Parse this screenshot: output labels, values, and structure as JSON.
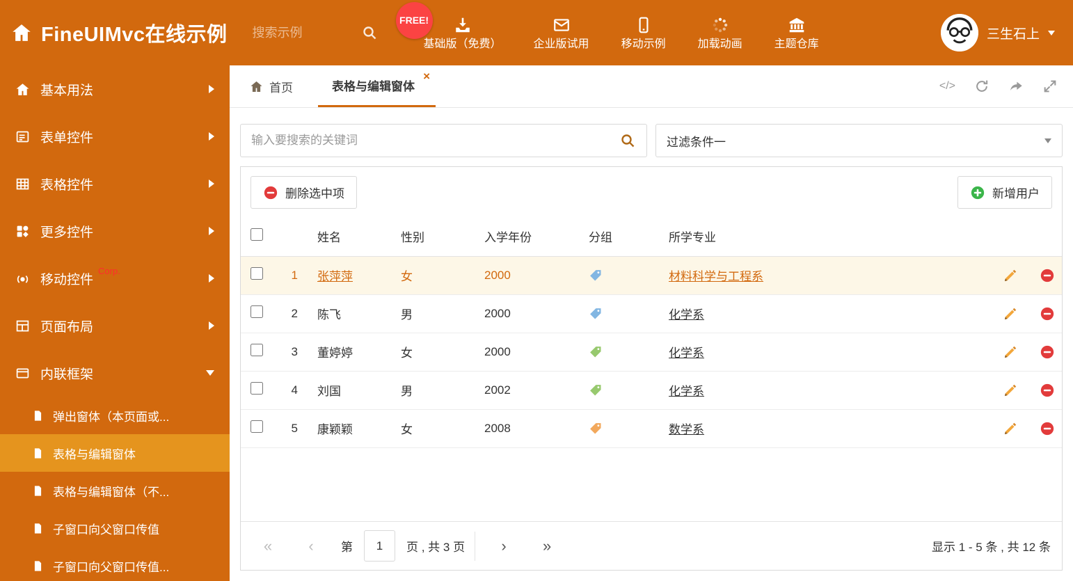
{
  "colors": {
    "primary": "#d2690e",
    "primary_light": "#e5941e",
    "link": "#d2690e",
    "red": "#e23b3b",
    "green": "#3bb54a",
    "free_red": "#fb4343",
    "selected_bg": "#fdf7e7",
    "tag_blue": "#82b6e2",
    "tag_green": "#97c96e",
    "tag_orange": "#f2a85c"
  },
  "icons": {
    "close": "×",
    "code": "</>",
    "first": "«",
    "prev": "‹",
    "next": "›",
    "last": "»"
  },
  "header": {
    "title": "FineUIMvc在线示例",
    "search_placeholder": "搜索示例",
    "free_badge": "FREE!",
    "nav": [
      {
        "label": "基础版（免费）"
      },
      {
        "label": "企业版试用"
      },
      {
        "label": "移动示例"
      },
      {
        "label": "加载动画"
      },
      {
        "label": "主题仓库"
      }
    ],
    "user_name": "三生石上"
  },
  "sidebar": {
    "items": [
      {
        "label": "基本用法",
        "arrow": "right"
      },
      {
        "label": "表单控件",
        "arrow": "right"
      },
      {
        "label": "表格控件",
        "arrow": "right"
      },
      {
        "label": "更多控件",
        "arrow": "right"
      },
      {
        "label": "移动控件",
        "badge": "Corp.",
        "arrow": "right"
      },
      {
        "label": "页面布局",
        "arrow": "right"
      },
      {
        "label": "内联框架",
        "arrow": "down"
      }
    ],
    "subitems": [
      {
        "label": "弹出窗体（本页面或...",
        "state": "normal"
      },
      {
        "label": "表格与编辑窗体",
        "state": "active"
      },
      {
        "label": "表格与编辑窗体（不...",
        "state": "normal"
      },
      {
        "label": "子窗口向父窗口传值",
        "state": "normal"
      },
      {
        "label": "子窗口向父窗口传值...",
        "state": "normal"
      }
    ]
  },
  "tabs": {
    "home": "首页",
    "active": "表格与编辑窗体"
  },
  "filter": {
    "search_placeholder": "输入要搜索的关键词",
    "dropdown_value": "过滤条件一"
  },
  "toolbar": {
    "delete_label": "删除选中项",
    "add_label": "新增用户"
  },
  "table": {
    "columns": [
      "姓名",
      "性别",
      "入学年份",
      "分组",
      "所学专业"
    ],
    "rows": [
      {
        "num": "1",
        "name": "张萍萍",
        "gender": "女",
        "year": "2000",
        "tag": "blue",
        "major": "材料科学与工程系",
        "state": "selected"
      },
      {
        "num": "2",
        "name": "陈飞",
        "gender": "男",
        "year": "2000",
        "tag": "blue",
        "major": "化学系",
        "state": "normal"
      },
      {
        "num": "3",
        "name": "董婷婷",
        "gender": "女",
        "year": "2000",
        "tag": "green",
        "major": "化学系",
        "state": "normal"
      },
      {
        "num": "4",
        "name": "刘国",
        "gender": "男",
        "year": "2002",
        "tag": "green",
        "major": "化学系",
        "state": "normal"
      },
      {
        "num": "5",
        "name": "康颖颖",
        "gender": "女",
        "year": "2008",
        "tag": "orange",
        "major": "数学系",
        "state": "normal"
      }
    ]
  },
  "pagination": {
    "prefix": "第",
    "page": "1",
    "suffix": "页 , 共 3 页",
    "summary": "显示 1 - 5 条 , 共 12 条"
  }
}
